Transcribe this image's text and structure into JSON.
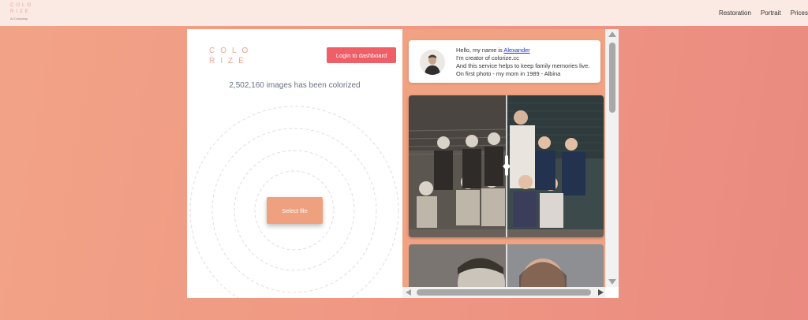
{
  "brand": {
    "logo_line1": "COLO",
    "logo_line2": "RIZE",
    "logo_tagline": "AI Company"
  },
  "nav": {
    "items": [
      "Restoration",
      "Portrait",
      "Prices"
    ]
  },
  "panel": {
    "login_label": "Login to dashboard",
    "counter_text": "2,502,160 images has been colorized",
    "select_file_label": "Select file"
  },
  "intro": {
    "line1_prefix": "Hello, my name is ",
    "author_link": "Alexander",
    "line2": "I'm creator of colorize.cc",
    "line3": "And this service helps to keep family memories live.",
    "line4": "On first photo - my mom in 1989 -  Albina"
  },
  "colors": {
    "accent": "#f05f67",
    "brand": "#eba48f",
    "select_button": "#eea07f",
    "link": "#1a33d6"
  },
  "icons": {
    "scroll_up": "triangle-up-icon",
    "scroll_down": "triangle-down-icon",
    "scroll_left": "triangle-left-icon",
    "scroll_right": "triangle-right-icon"
  }
}
